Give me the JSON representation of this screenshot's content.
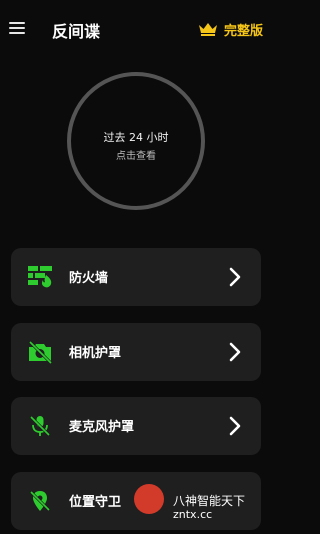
{
  "header": {
    "menu_icon": "menu-icon",
    "title": "反间谍",
    "premium_icon": "crown-icon",
    "premium_label": "完整版"
  },
  "summary": {
    "line1": "过去 24 小时",
    "line2": "点击查看"
  },
  "items": [
    {
      "label": "防火墙",
      "icon": "firewall-icon"
    },
    {
      "label": "相机护罩",
      "icon": "camera-off-icon"
    },
    {
      "label": "麦克风护罩",
      "icon": "mic-off-icon"
    },
    {
      "label": "位置守卫",
      "icon": "location-off-icon"
    }
  ],
  "watermark": {
    "line1": "八神智能天下",
    "line2": "zntx.cc"
  },
  "colors": {
    "accent_green": "#2ecc2e",
    "premium_gold": "#f5c518",
    "background": "#0b0b0b",
    "card": "#1f1f1f",
    "ring": "#555555"
  }
}
